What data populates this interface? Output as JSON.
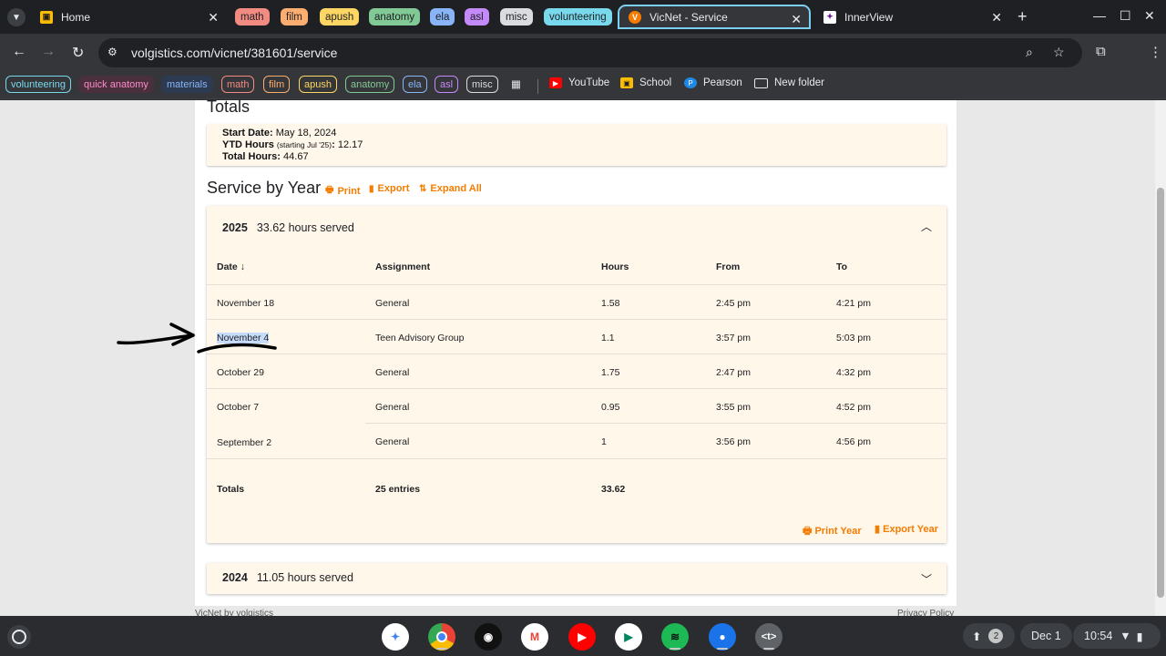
{
  "tabs": {
    "home": {
      "title": "Home"
    },
    "groups": [
      {
        "label": "math",
        "color": "#f28b82"
      },
      {
        "label": "film",
        "color": "#fcad70"
      },
      {
        "label": "apush",
        "color": "#fdd663"
      },
      {
        "label": "anatomy",
        "color": "#81c995"
      },
      {
        "label": "ela",
        "color": "#8ab4f8"
      },
      {
        "label": "asl",
        "color": "#c58af9"
      },
      {
        "label": "misc",
        "color": "#dadce0"
      },
      {
        "label": "volunteering",
        "color": "#78d9ec"
      }
    ],
    "active": {
      "title": "VicNet - Service"
    },
    "innerview": {
      "title": "InnerView"
    }
  },
  "toolbar": {
    "url": "volgistics.com/vicnet/381601/service"
  },
  "bookmarks": {
    "chips": [
      {
        "label": "volunteering",
        "color": "#78d9ec"
      },
      {
        "label": "quick anatomy",
        "color": "#ff8bcb"
      },
      {
        "label": "materials",
        "color": "#8ab4f8"
      },
      {
        "label": "math",
        "color": "#f28b82"
      },
      {
        "label": "film",
        "color": "#fcad70"
      },
      {
        "label": "apush",
        "color": "#fdd663"
      },
      {
        "label": "anatomy",
        "color": "#81c995"
      },
      {
        "label": "ela",
        "color": "#8ab4f8"
      },
      {
        "label": "asl",
        "color": "#c58af9"
      },
      {
        "label": "misc",
        "color": "#dadce0"
      }
    ],
    "links": [
      "YouTube",
      "School",
      "Pearson",
      "New folder"
    ]
  },
  "totals": {
    "title": "Totals",
    "start_label": "Start Date:",
    "start_value": "May 18, 2024",
    "ytd_label": "YTD Hours",
    "ytd_note": "(starting Jul '25)",
    "ytd_colon": ":",
    "ytd_value": "12.17",
    "total_label": "Total Hours:",
    "total_value": "44.67"
  },
  "service": {
    "title": "Service by Year",
    "print": "Print",
    "export": "Export",
    "expand_all": "Expand All"
  },
  "year2025": {
    "year": "2025",
    "summary": "33.62 hours served",
    "columns": [
      "Date",
      "Assignment",
      "Hours",
      "From",
      "To"
    ],
    "rows": [
      {
        "date": "November 18",
        "assignment": "General",
        "hours": "1.58",
        "from": "2:45 pm",
        "to": "4:21 pm"
      },
      {
        "date": "November 4",
        "assignment": "Teen Advisory Group",
        "hours": "1.1",
        "from": "3:57 pm",
        "to": "5:03 pm"
      },
      {
        "date": "October 29",
        "assignment": "General",
        "hours": "1.75",
        "from": "2:47 pm",
        "to": "4:32 pm"
      },
      {
        "date": "October 7",
        "assignment": "General",
        "hours": "0.95",
        "from": "3:55 pm",
        "to": "4:52 pm"
      },
      {
        "date": "September 2",
        "assignment": "General",
        "hours": "1",
        "from": "3:56 pm",
        "to": "4:56 pm"
      }
    ],
    "totals_label": "Totals",
    "entries": "25 entries",
    "total_hours": "33.62",
    "print_year": "Print Year",
    "export_year": "Export Year"
  },
  "year2024": {
    "year": "2024",
    "summary": "11.05 hours served"
  },
  "footer": {
    "left": "VicNet by volgistics",
    "right": "Privacy Policy"
  },
  "shelf": {
    "notification_count": "2",
    "date": "Dec 1",
    "time": "10:54"
  }
}
